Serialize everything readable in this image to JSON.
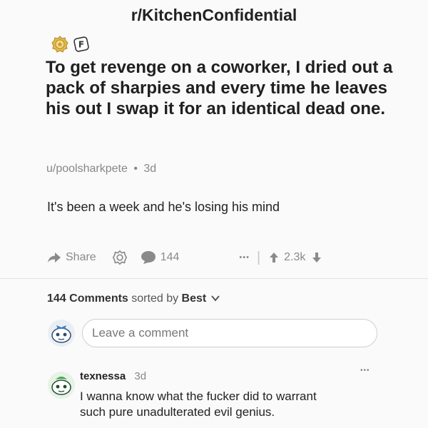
{
  "subreddit": "r/KitchenConfidential",
  "badges": {
    "award_icon": "gold-award-icon",
    "flair_letter": "F"
  },
  "post": {
    "title": "To get revenge on a coworker, I dried out a pack of sharpies and every time he leaves his out I swap it for an identical dead one.",
    "author": "u/poolsharkpete",
    "separator": "•",
    "age": "3d",
    "body": "It's been a week and he's losing his mind"
  },
  "actions": {
    "share_label": "Share",
    "comment_count": "144",
    "more_label": "•••",
    "pipe": "|",
    "score": "2.3k"
  },
  "comments_header": {
    "count_label": "144 Comments",
    "sorted_by_label": "sorted by",
    "sort_value": "Best"
  },
  "comment_input": {
    "placeholder": "Leave a comment"
  },
  "comments": [
    {
      "username": "texnessa",
      "age": "3d",
      "more_label": "•••",
      "line1": "I wanna know what the fucker did to warrant",
      "line2": "such pure unadulterated evil genius."
    }
  ],
  "colors": {
    "accent": "#4aa3e0",
    "muted": "#8a8a8a",
    "divider": "#e3e3e3"
  }
}
